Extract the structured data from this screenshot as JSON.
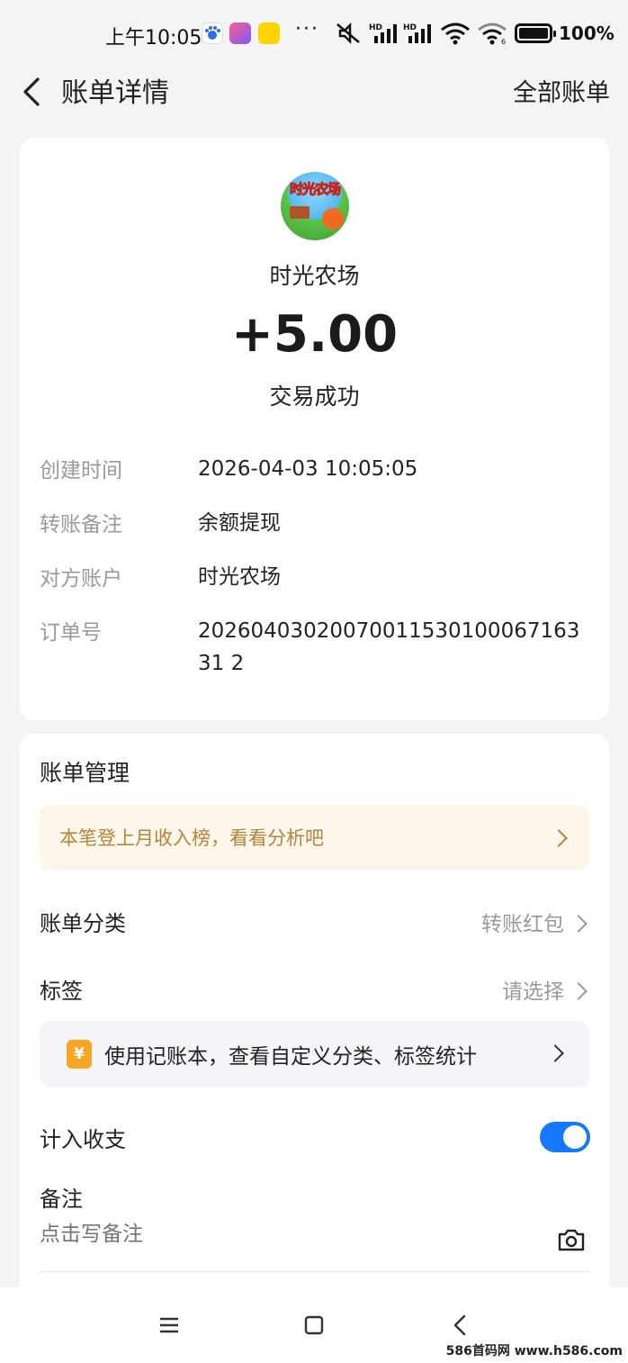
{
  "status_bar": {
    "time": "上午10:05",
    "battery": "100%"
  },
  "header": {
    "title": "账单详情",
    "right_link": "全部账单"
  },
  "bill": {
    "logo_text": "时光农场",
    "merchant": "时光农场",
    "amount": "+5.00",
    "status": "交易成功",
    "details": [
      {
        "label": "创建时间",
        "value": "2026-04-03 10:05:05"
      },
      {
        "label": "转账备注",
        "value": "余额提现"
      },
      {
        "label": "对方账户",
        "value": "时光农场"
      },
      {
        "label": "订单号",
        "value": "2026040302007001153010006716331 2"
      }
    ]
  },
  "management": {
    "title": "账单管理",
    "promo": "本笔登上月收入榜，看看分析吧",
    "category_label": "账单分类",
    "category_value": "转账红包",
    "tag_label": "标签",
    "tag_value": "请选择",
    "tip_icon": "¥",
    "tip_text": "使用记账本，查看自定义分类、标签统计",
    "count_label": "计入收支",
    "count_enabled": true,
    "note_label": "备注",
    "note_placeholder": "点击写备注"
  },
  "watermark": "586首码网 www.h586.com",
  "colors": {
    "accent": "#1677ff",
    "promo_text": "#b8833a",
    "promo_bg": "#fdf6ea"
  }
}
